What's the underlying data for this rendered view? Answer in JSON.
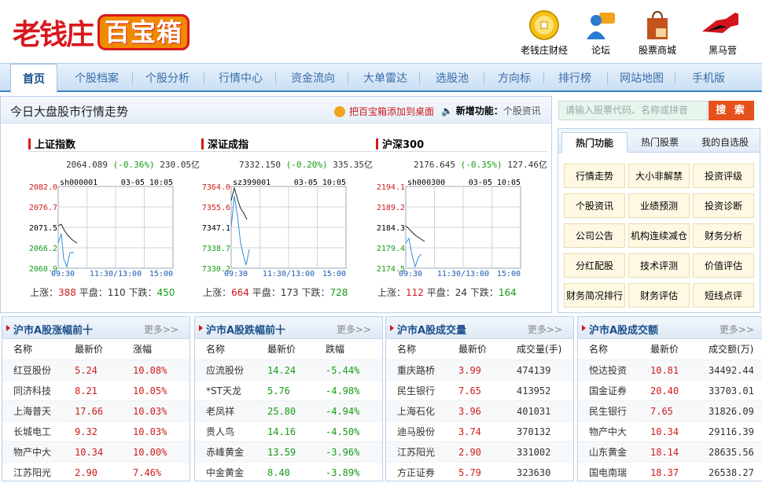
{
  "brand": {
    "name_part1": "老钱庄",
    "name_part2": "百宝箱"
  },
  "top_links": [
    {
      "label": "老钱庄财经",
      "icon": "coin-icon"
    },
    {
      "label": "论坛",
      "icon": "forum-user-icon"
    },
    {
      "label": "股票商城",
      "icon": "shopping-bag-icon"
    },
    {
      "label": "黑马营",
      "icon": "horse-icon"
    }
  ],
  "nav": [
    "首页",
    "个股档案",
    "个股分析",
    "行情中心",
    "资金流向",
    "大单雷达",
    "选股池",
    "方向标",
    "排行榜",
    "网站地图",
    "手机版"
  ],
  "market": {
    "title": "今日大盘股市行情走势",
    "add_desktop": "把百宝箱添加到桌面",
    "new_feature_label": "新增功能：",
    "new_feature_value": "个股资讯",
    "up_label": "上涨：",
    "flat_label": "平盘：",
    "down_label": "下跌：",
    "indices": [
      {
        "name": "上证指数",
        "price": "2064.089",
        "change": "(-0.36%)",
        "amount": "230.05亿",
        "code": "sh000001",
        "date": "03-05 10:05",
        "y_ticks": [
          "2082.0",
          "2076.7",
          "2071.5",
          "2066.2",
          "2060.9"
        ],
        "times": [
          "09:30",
          "11:30/13:00",
          "15:00"
        ],
        "up": "388",
        "flat": "110",
        "down": "450"
      },
      {
        "name": "深证成指",
        "price": "7332.150",
        "change": "(-0.20%)",
        "amount": "335.35亿",
        "code": "sz399001",
        "date": "03-05 10:05",
        "y_ticks": [
          "7364.0",
          "7355.6",
          "7347.1",
          "7338.7",
          "7330.2"
        ],
        "times": [
          "09:30",
          "11:30/13:00",
          "15:00"
        ],
        "up": "664",
        "flat": "173",
        "down": "728"
      },
      {
        "name": "沪深300",
        "price": "2176.645",
        "change": "(-0.35%)",
        "amount": "127.46亿",
        "code": "sh000300",
        "date": "03-05 10:05",
        "y_ticks": [
          "2194.1",
          "2189.2",
          "2184.3",
          "2179.4",
          "2174.5"
        ],
        "times": [
          "09:30",
          "11:30/13:00",
          "15:00"
        ],
        "up": "112",
        "flat": "24",
        "down": "164"
      }
    ]
  },
  "search": {
    "placeholder": "请输入股票代码、名称或拼音",
    "button": "搜 索"
  },
  "hot": {
    "tabs": [
      "热门功能",
      "热门股票",
      "我的自选股"
    ],
    "items": [
      "行情走势",
      "大小非解禁",
      "投资评级",
      "个股资讯",
      "业绩预测",
      "投资诊断",
      "公司公告",
      "机构连续减仓",
      "财务分析",
      "分红配股",
      "技术评测",
      "价值评估",
      "财务简况排行",
      "财务评估",
      "短线点评"
    ]
  },
  "more_label": "更多>>",
  "panels": [
    {
      "title": "沪市A股涨幅前十",
      "headers": [
        "名称",
        "最新价",
        "涨幅"
      ],
      "rows": [
        [
          "红豆股份",
          "5.24",
          "10.08%"
        ],
        [
          "同济科技",
          "8.21",
          "10.05%"
        ],
        [
          "上海普天",
          "17.66",
          "10.03%"
        ],
        [
          "长城电工",
          "9.32",
          "10.03%"
        ],
        [
          "物产中大",
          "10.34",
          "10.00%"
        ],
        [
          "江苏阳光",
          "2.90",
          "7.46%"
        ]
      ]
    },
    {
      "title": "沪市A股跌幅前十",
      "headers": [
        "名称",
        "最新价",
        "跌幅"
      ],
      "rows": [
        [
          "应流股份",
          "14.24",
          "-5.44%"
        ],
        [
          "*ST天龙",
          "5.76",
          "-4.98%"
        ],
        [
          "老凤祥",
          "25.80",
          "-4.94%"
        ],
        [
          "贵人鸟",
          "14.16",
          "-4.50%"
        ],
        [
          "赤峰黄金",
          "13.59",
          "-3.96%"
        ],
        [
          "中金黄金",
          "8.40",
          "-3.89%"
        ]
      ]
    },
    {
      "title": "沪市A股成交量",
      "headers": [
        "名称",
        "最新价",
        "成交量(手)"
      ],
      "rows": [
        [
          "重庆路桥",
          "3.99",
          "474139"
        ],
        [
          "民生银行",
          "7.65",
          "413952"
        ],
        [
          "上海石化",
          "3.96",
          "401031"
        ],
        [
          "迪马股份",
          "3.74",
          "370132"
        ],
        [
          "江苏阳光",
          "2.90",
          "331002"
        ],
        [
          "方正证券",
          "5.79",
          "323630"
        ]
      ]
    },
    {
      "title": "沪市A股成交额",
      "headers": [
        "名称",
        "最新价",
        "成交额(万)"
      ],
      "rows": [
        [
          "悦达投资",
          "10.81",
          "34492.44"
        ],
        [
          "国金证券",
          "20.40",
          "33703.01"
        ],
        [
          "民生银行",
          "7.65",
          "31826.09"
        ],
        [
          "物产中大",
          "10.34",
          "29116.39"
        ],
        [
          "山东黄金",
          "18.14",
          "28635.56"
        ],
        [
          "国电南瑞",
          "18.37",
          "26538.27"
        ]
      ]
    }
  ],
  "colors": {
    "up": "#d01b1b",
    "down": "#169a16",
    "nav_border": "#3e82c6",
    "search_button": "#e4511b"
  }
}
